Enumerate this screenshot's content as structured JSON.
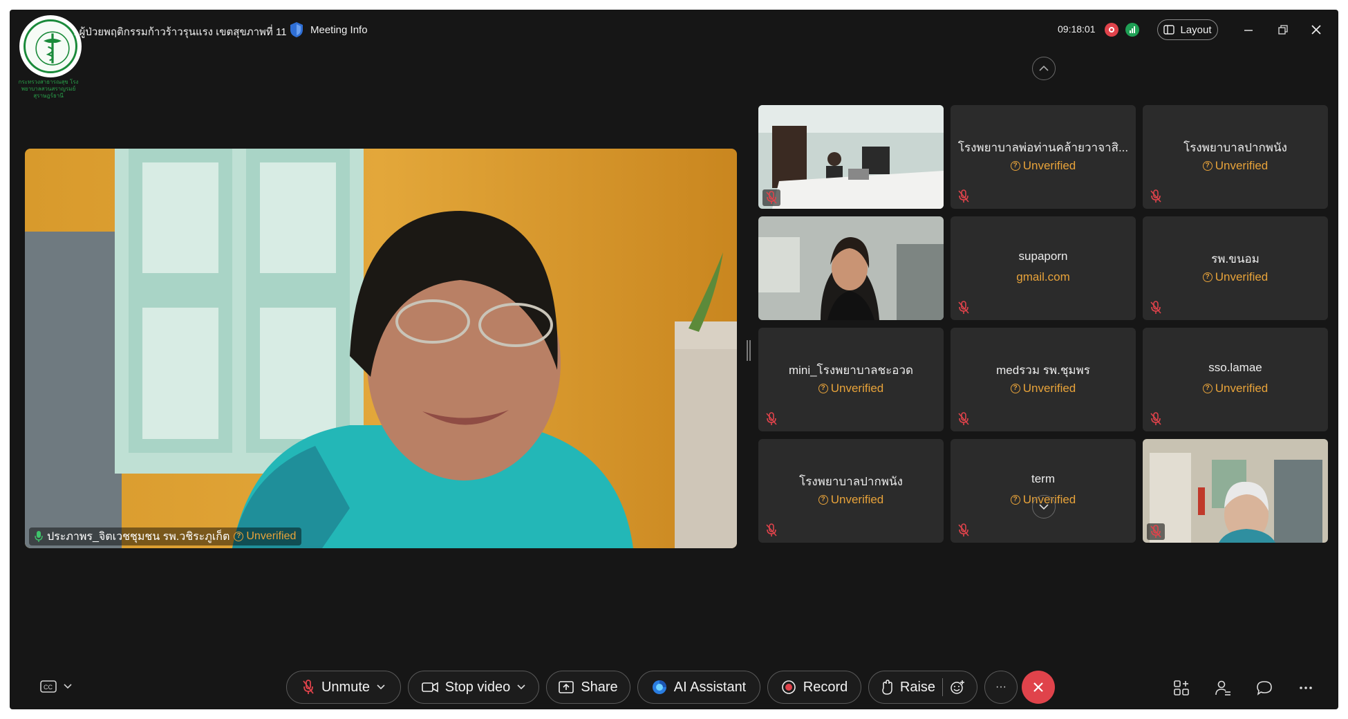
{
  "window": {
    "meeting_name": "...ผู้ป่วยพฤติกรรมก้าวร้าวรุนแรง เขตสุขภาพที่ 11",
    "meeting_info_label": "Meeting Info",
    "clock": "09:18:01",
    "layout_label": "Layout",
    "logo_caption": "กระทรวงสาธารณสุข โรงพยาบาลสวนสราญรมย์ สุราษฎร์ธานี"
  },
  "main_speaker": {
    "name": "ประภาพร_จิตเวชชุมชน รพ.วชิระภูเก็ต",
    "status": "Unverified"
  },
  "participants": [
    {
      "name": "",
      "sub": "",
      "type": "video",
      "muted": true
    },
    {
      "name": "โรงพยาบาลพ่อท่านคล้ายวาจาสิ...",
      "sub": "Unverified",
      "type": "text",
      "muted": true
    },
    {
      "name": "โรงพยาบาลปากพนัง",
      "sub": "Unverified",
      "type": "text",
      "muted": true
    },
    {
      "name": "",
      "sub": "",
      "type": "video",
      "muted": false
    },
    {
      "name": "supaporn",
      "sub": "gmail.com",
      "type": "email",
      "muted": true
    },
    {
      "name": "รพ.ขนอม",
      "sub": "Unverified",
      "type": "text",
      "muted": true
    },
    {
      "name": "mini_โรงพยาบาลชะอวด",
      "sub": "Unverified",
      "type": "text",
      "muted": true
    },
    {
      "name": "medรวม รพ.ชุมพร",
      "sub": "Unverified",
      "type": "text",
      "muted": true
    },
    {
      "name": "sso.lamae",
      "sub": "Unverified",
      "type": "text",
      "muted": true
    },
    {
      "name": "โรงพยาบาลปากพนัง",
      "sub": "Unverified",
      "type": "text",
      "muted": true
    },
    {
      "name": "term",
      "sub": "Unverified",
      "type": "text",
      "muted": true
    },
    {
      "name": "",
      "sub": "",
      "type": "video",
      "muted": true
    }
  ],
  "toolbar": {
    "unmute_label": "Unmute",
    "stop_video_label": "Stop video",
    "share_label": "Share",
    "ai_assistant_label": "AI Assistant",
    "record_label": "Record",
    "raise_label": "Raise",
    "more_label": "···"
  },
  "colors": {
    "background": "#161616",
    "tile": "#2b2b2b",
    "unverified": "#e8a33a",
    "end_call": "#e0434b",
    "record": "#e0434b",
    "signal": "#1fa055"
  }
}
